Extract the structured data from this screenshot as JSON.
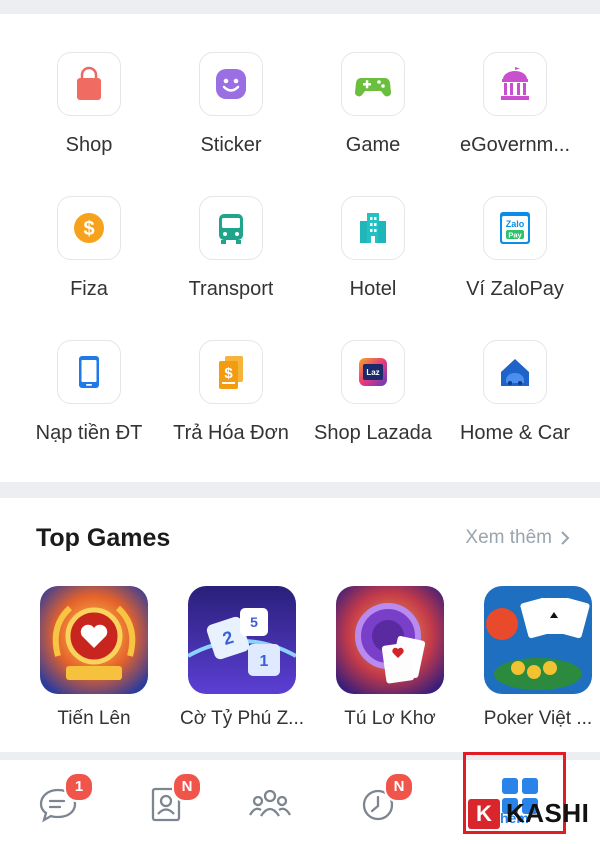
{
  "utilities": [
    {
      "label": "Shop",
      "icon": "shopping-bag-icon"
    },
    {
      "label": "Sticker",
      "icon": "smiley-sticker-icon"
    },
    {
      "label": "Game",
      "icon": "gamepad-icon"
    },
    {
      "label": "eGovernm...",
      "icon": "government-building-icon"
    },
    {
      "label": "Fiza",
      "icon": "dollar-coin-icon"
    },
    {
      "label": "Transport",
      "icon": "bus-icon"
    },
    {
      "label": "Hotel",
      "icon": "hotel-building-icon"
    },
    {
      "label": "Ví ZaloPay",
      "icon": "zalopay-wallet-icon"
    },
    {
      "label": "Nạp tiền ĐT",
      "icon": "phone-topup-icon"
    },
    {
      "label": "Trả Hóa Đơn",
      "icon": "bill-receipt-icon"
    },
    {
      "label": "Shop Lazada",
      "icon": "lazada-icon"
    },
    {
      "label": "Home & Car",
      "icon": "home-car-icon"
    }
  ],
  "zalopay_logo": {
    "line1": "Zalo",
    "line2": "Pay"
  },
  "lazada_logo": "Laz",
  "top_games": {
    "title": "Top Games",
    "see_more": "Xem thêm",
    "items": [
      {
        "name": "Tiến Lên"
      },
      {
        "name": "Cờ Tỷ Phú Z..."
      },
      {
        "name": "Tú Lơ Khơ"
      },
      {
        "name": "Poker Việt ..."
      }
    ]
  },
  "dice_faces": [
    "2",
    "5",
    "1"
  ],
  "tabbar": {
    "messages_badge": "1",
    "contacts_badge": "N",
    "timeline_badge": "N",
    "more_label": "hêm"
  },
  "watermark": {
    "k": "K",
    "text": "KASHI"
  },
  "colors": {
    "badge": "#f0554b",
    "highlight": "#e21c24",
    "accent": "#2a83e8"
  }
}
